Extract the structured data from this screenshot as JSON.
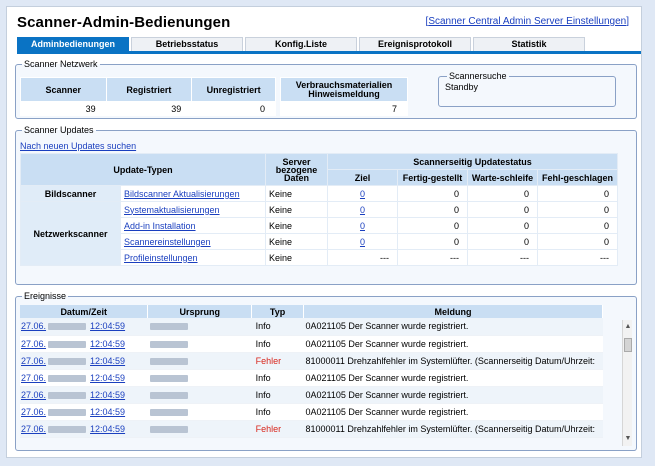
{
  "header": {
    "title": "Scanner-Admin-Bedienungen",
    "settings_link": "Scanner Central Admin Server Einstellungen"
  },
  "tabs": [
    {
      "label": "Adminbedienungen",
      "active": true
    },
    {
      "label": "Betriebsstatus",
      "active": false
    },
    {
      "label": "Konfig.Liste",
      "active": false
    },
    {
      "label": "Ereignisprotokoll",
      "active": false
    },
    {
      "label": "Statistik",
      "active": false
    }
  ],
  "network": {
    "legend": "Scanner Netzwerk",
    "headers": [
      "Scanner",
      "Registriert",
      "Unregistriert"
    ],
    "values": [
      "39",
      "39",
      "0"
    ],
    "supplies_header": "Verbrauchsmaterialien Hinweismeldung",
    "supplies_value": "7",
    "search_legend": "Scannersuche",
    "search_status": "Standby"
  },
  "updates": {
    "legend": "Scanner Updates",
    "search_link": "Nach neuen Updates suchen",
    "col_type": "Update-Typen",
    "col_server": "Server bezogene Daten",
    "col_status": "Scannerseitig Updatestatus",
    "sub_cols": [
      "Ziel",
      "Fertig-gestellt",
      "Warte-schleife",
      "Fehl-geschlagen"
    ],
    "group_image": "Bildscanner",
    "group_network": "Netzwerkscanner",
    "rows": [
      {
        "name": "Bildscanner Aktualisierungen",
        "server": "Keine",
        "ziel": "0",
        "fertig": "0",
        "warte": "0",
        "fehl": "0"
      },
      {
        "name": "Systemaktualisierungen",
        "server": "Keine",
        "ziel": "0",
        "fertig": "0",
        "warte": "0",
        "fehl": "0"
      },
      {
        "name": "Add-in Installation",
        "server": "Keine",
        "ziel": "0",
        "fertig": "0",
        "warte": "0",
        "fehl": "0"
      },
      {
        "name": "Scannereinstellungen",
        "server": "Keine",
        "ziel": "0",
        "fertig": "0",
        "warte": "0",
        "fehl": "0"
      },
      {
        "name": "Profileinstellungen",
        "server": "Keine",
        "ziel": "---",
        "fertig": "---",
        "warte": "---",
        "fehl": "---"
      }
    ]
  },
  "events": {
    "legend": "Ereignisse",
    "headers": [
      "Datum/Zeit",
      "Ursprung",
      "Typ",
      "Meldung"
    ],
    "rows": [
      {
        "date": "27.06.",
        "time": "12:04:59",
        "type": "Info",
        "error": false,
        "message": "0A021105  Der Scanner wurde registriert."
      },
      {
        "date": "27.06.",
        "time": "12:04:59",
        "type": "Info",
        "error": false,
        "message": "0A021105  Der Scanner wurde registriert."
      },
      {
        "date": "27.06.",
        "time": "12:04:59",
        "type": "Fehler",
        "error": true,
        "message": "81000011  Drehzahlfehler im Systemlüfter. (Scannerseitig Datum/Uhrzeit:"
      },
      {
        "date": "27.06.",
        "time": "12:04:59",
        "type": "Info",
        "error": false,
        "message": "0A021105  Der Scanner wurde registriert."
      },
      {
        "date": "27.06.",
        "time": "12:04:59",
        "type": "Info",
        "error": false,
        "message": "0A021105  Der Scanner wurde registriert."
      },
      {
        "date": "27.06.",
        "time": "12:04:59",
        "type": "Info",
        "error": false,
        "message": "0A021105  Der Scanner wurde registriert."
      },
      {
        "date": "27.06.",
        "time": "12:04:59",
        "type": "Fehler",
        "error": true,
        "message": "81000011  Drehzahlfehler im Systemlüfter. (Scannerseitig Datum/Uhrzeit:"
      }
    ]
  },
  "colors": {
    "accent": "#0a73c4",
    "link": "#1a3fbf",
    "error": "#d9261c",
    "header_bg": "#c9def3"
  }
}
